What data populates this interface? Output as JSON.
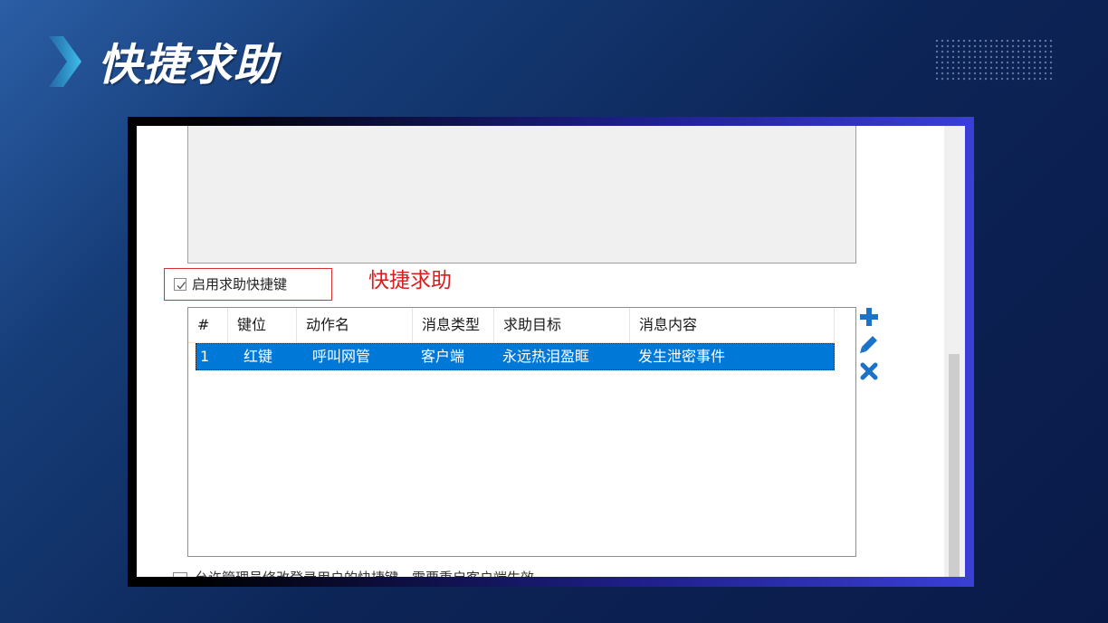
{
  "slide": {
    "title": "快捷求助"
  },
  "dialog": {
    "enable_checkbox": {
      "label": "启用求助快捷键",
      "checked": true
    },
    "annotation": "快捷求助",
    "table": {
      "columns": [
        "#",
        "键位",
        "动作名",
        "消息类型",
        "求助目标",
        "消息内容"
      ],
      "rows": [
        {
          "index": "1",
          "key": "红键",
          "action": "呼叫网管",
          "msg_type": "客户端",
          "target": "永远热泪盈眶",
          "content": "发生泄密事件",
          "selected": true
        }
      ]
    },
    "side_actions": [
      {
        "name": "add",
        "icon": "plus-icon"
      },
      {
        "name": "edit",
        "icon": "pencil-icon"
      },
      {
        "name": "delete",
        "icon": "x-icon"
      }
    ],
    "bottom_option": {
      "label": "允许管理员修改登录用户的快捷键，需要重启客户端生效",
      "checked": false
    }
  },
  "colors": {
    "selection": "#0078d7",
    "icon_blue": "#1a73c9",
    "annotation_red": "#d81e1e"
  }
}
